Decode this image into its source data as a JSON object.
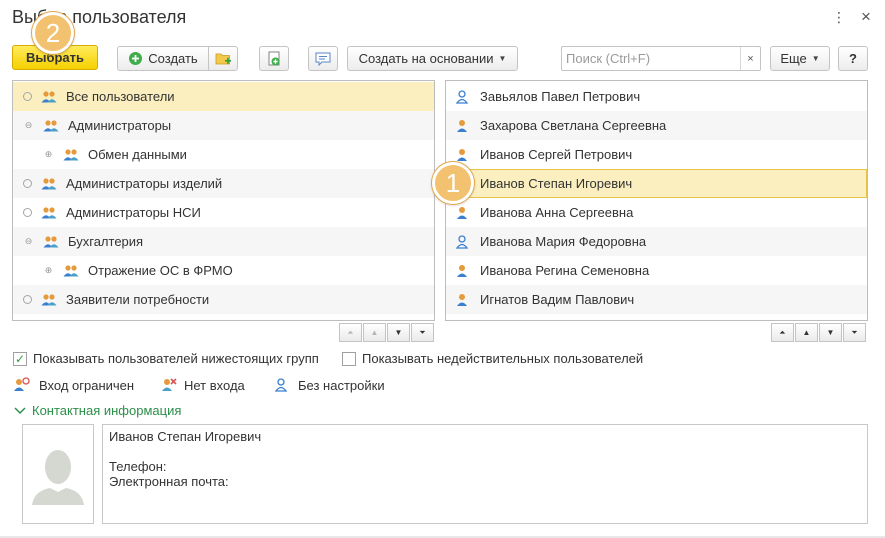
{
  "window": {
    "title": "Выбор пользователя",
    "more_glyph": "⋮",
    "close_glyph": "×"
  },
  "toolbar": {
    "select_label": "Выбрать",
    "create_label": "Создать",
    "create_based_label": "Создать на основании",
    "search_placeholder": "Поиск (Ctrl+F)",
    "search_value": "",
    "search_clear": "×",
    "more_label": "Еще",
    "help_label": "?"
  },
  "groups": [
    {
      "label": "Все пользователи",
      "level": 0,
      "toggle": "radio",
      "selected": true
    },
    {
      "label": "Администраторы",
      "level": 0,
      "toggle": "minus",
      "selected": false
    },
    {
      "label": "Обмен данными",
      "level": 1,
      "toggle": "plus",
      "selected": false
    },
    {
      "label": "Администраторы изделий",
      "level": 0,
      "toggle": "radio",
      "selected": false
    },
    {
      "label": "Администраторы НСИ",
      "level": 0,
      "toggle": "radio",
      "selected": false
    },
    {
      "label": "Бухгалтерия",
      "level": 0,
      "toggle": "minus",
      "selected": false
    },
    {
      "label": "Отражение ОС в ФРМО",
      "level": 1,
      "toggle": "plus",
      "selected": false
    },
    {
      "label": "Заявители потребности",
      "level": 0,
      "toggle": "radio",
      "selected": false
    }
  ],
  "users": [
    {
      "name": "Завьялов Павел Петрович",
      "icon": "user-no-settings-icon",
      "selected": false
    },
    {
      "name": "Захарова Светлана Сергеевна",
      "icon": "user-icon",
      "selected": false
    },
    {
      "name": "Иванов Сергей Петрович",
      "icon": "user-icon",
      "selected": false
    },
    {
      "name": "Иванов Степан Игоревич",
      "icon": "user-icon",
      "selected": true
    },
    {
      "name": "Иванова Анна Сергеевна",
      "icon": "user-icon",
      "selected": false
    },
    {
      "name": "Иванова Мария Федоровна",
      "icon": "user-no-settings-icon",
      "selected": false
    },
    {
      "name": "Иванова Регина Семеновна",
      "icon": "user-icon",
      "selected": false
    },
    {
      "name": "Игнатов Вадим Павлович",
      "icon": "user-icon",
      "selected": false
    }
  ],
  "options": {
    "show_subgroups_label": "Показывать пользователей нижестоящих групп",
    "show_subgroups_checked": true,
    "show_invalid_label": "Показывать недействительных пользователей",
    "show_invalid_checked": false
  },
  "legend": {
    "restricted": "Вход ограничен",
    "no_login": "Нет входа",
    "no_settings": "Без настройки"
  },
  "contact": {
    "section_label": "Контактная информация",
    "name": "Иванов Степан Игоревич",
    "phone_label": "Телефон:",
    "email_label": "Электронная почта:"
  },
  "annotations": {
    "badge_1": "1",
    "badge_2": "2"
  },
  "colors": {
    "primary_button": "#f5d000",
    "selection": "#fbefbf",
    "link_green": "#2a8f48",
    "badge": "#f3c271"
  }
}
